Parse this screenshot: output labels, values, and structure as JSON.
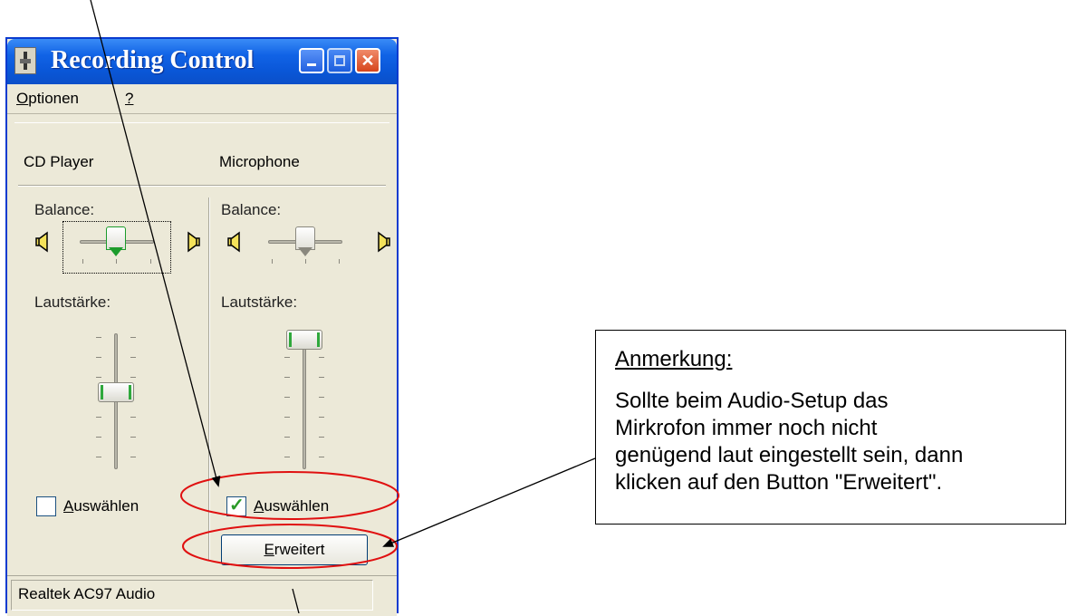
{
  "window": {
    "title": "Recording Control",
    "menu": {
      "optionen_first": "O",
      "optionen_rest": "ptionen",
      "help": "?"
    },
    "channels": [
      {
        "name": "CD Player",
        "balance_label": "Balance:",
        "volume_label": "Lautstärke:",
        "select_first": "A",
        "select_rest": "uswählen",
        "selected": false
      },
      {
        "name": "Microphone",
        "balance_label": "Balance:",
        "volume_label": "Lautstärke:",
        "select_first": "A",
        "select_rest": "uswählen",
        "selected": true,
        "advanced_first": "E",
        "advanced_rest": "rweitert"
      }
    ],
    "status": "Realtek AC97 Audio"
  },
  "annotation": {
    "title": "Anmerkung:",
    "lines": [
      "Sollte beim Audio-Setup das",
      "Mirkrofon immer noch nicht",
      "genügend laut eingestellt sein, dann",
      "klicken auf den Button \"Erweitert\"."
    ]
  },
  "colors": {
    "titlebar": "#0a57d8",
    "window_bg": "#ece9d8",
    "highlight_ellipse": "#e01010",
    "slider_accent": "#2fa83c"
  },
  "icons": [
    "app-icon",
    "minimize-icon",
    "maximize-icon",
    "close-icon",
    "speaker-left-icon",
    "speaker-right-icon",
    "checkmark-icon"
  ]
}
